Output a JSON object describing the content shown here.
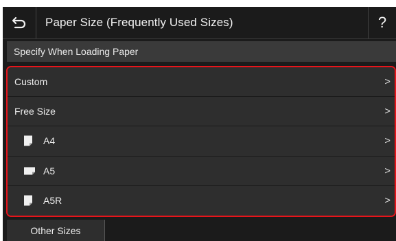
{
  "header": {
    "back_icon": "back-arrow-icon",
    "title": "Paper Size (Frequently Used Sizes)",
    "help_label": "?"
  },
  "specify_label": "Specify When Loading Paper",
  "items": [
    {
      "label": "Custom",
      "icon": null
    },
    {
      "label": "Free Size",
      "icon": null
    },
    {
      "label": "A4",
      "icon": "portrait-paper-icon"
    },
    {
      "label": "A5",
      "icon": "landscape-paper-icon"
    },
    {
      "label": "A5R",
      "icon": "portrait-paper-icon"
    }
  ],
  "chevron": ">",
  "other_sizes_label": "Other Sizes",
  "colors": {
    "highlight": "#e8141a",
    "background": "#1b1b1b",
    "row": "#2e2e2e"
  }
}
